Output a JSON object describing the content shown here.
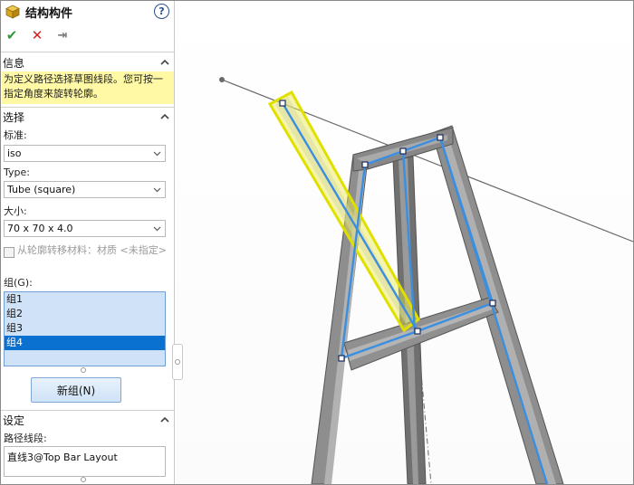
{
  "panel": {
    "title": "结构构件",
    "help_label": "?",
    "title_icon": "structural-member-cube-icon",
    "actions": {
      "ok": "✔",
      "cancel": "✕",
      "pin": "⇥"
    }
  },
  "info": {
    "header": "信息",
    "text": "为定义路径选择草图线段。您可按一指定角度来旋转轮廓。"
  },
  "selection": {
    "header": "选择",
    "standard_label": "标准:",
    "standard_value": "iso",
    "type_label": "Type:",
    "type_value": "Tube (square)",
    "size_label": "大小:",
    "size_value": "70 x 70 x 4.0",
    "transfer_material_label": "从轮廓转移材料：材质 <未指定>",
    "transfer_material_checked": false,
    "groups_label": "组(G):",
    "groups": [
      "组1",
      "组2",
      "组3",
      "组4"
    ],
    "selected_group": "组4",
    "new_group_button": "新组(N)"
  },
  "settings": {
    "header": "设定",
    "path_segment_label": "路径线段:",
    "path_segment_value": "直线3@Top Bar Layout"
  },
  "colors": {
    "info_highlight": "#fff9a6",
    "list_bg": "#cfe2f7",
    "list_selected": "#0a71d1",
    "member_gray": "#8e8e8e",
    "sketch_blue": "#3a8fe0",
    "selected_yellow": "#e8e84a"
  }
}
